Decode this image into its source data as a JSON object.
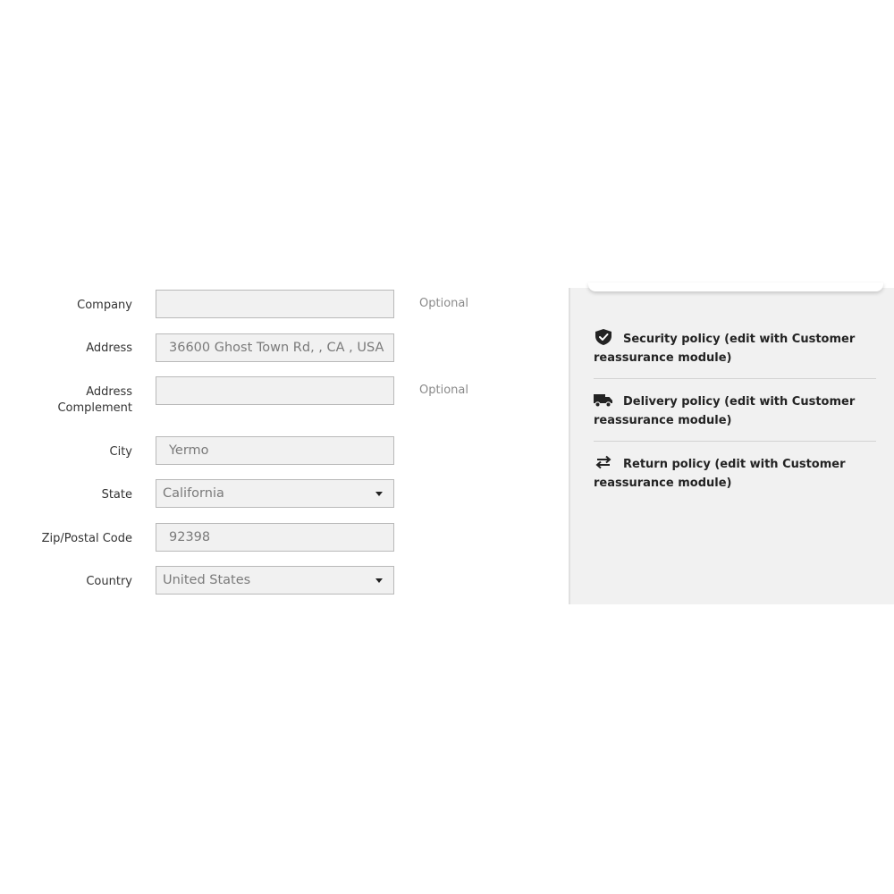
{
  "form": {
    "company": {
      "label": "Company",
      "value": "",
      "optional": "Optional"
    },
    "address": {
      "label": "Address",
      "value": "36600 Ghost Town Rd, , CA , USA"
    },
    "address_complement": {
      "label_line1": "Address",
      "label_line2": "Complement",
      "value": "",
      "optional": "Optional"
    },
    "city": {
      "label": "City",
      "value": "Yermo"
    },
    "state": {
      "label": "State",
      "value": "California"
    },
    "zip": {
      "label": "Zip/Postal Code",
      "value": "92398"
    },
    "country": {
      "label": "Country",
      "value": "United States"
    }
  },
  "reassurance": {
    "items": [
      {
        "icon": "shield-check-icon",
        "text": "Security policy (edit with Customer reassurance module)"
      },
      {
        "icon": "truck-icon",
        "text": "Delivery policy (edit with Customer reassurance module)"
      },
      {
        "icon": "swap-arrows-icon",
        "text": "Return policy (edit with Customer reassurance module)"
      }
    ]
  },
  "colors": {
    "field_background": "#f1f1f1",
    "field_border": "#b9b9b9",
    "panel_background": "#f1f1f1",
    "text_dark": "#232323",
    "text_muted": "#8a8a8a"
  }
}
